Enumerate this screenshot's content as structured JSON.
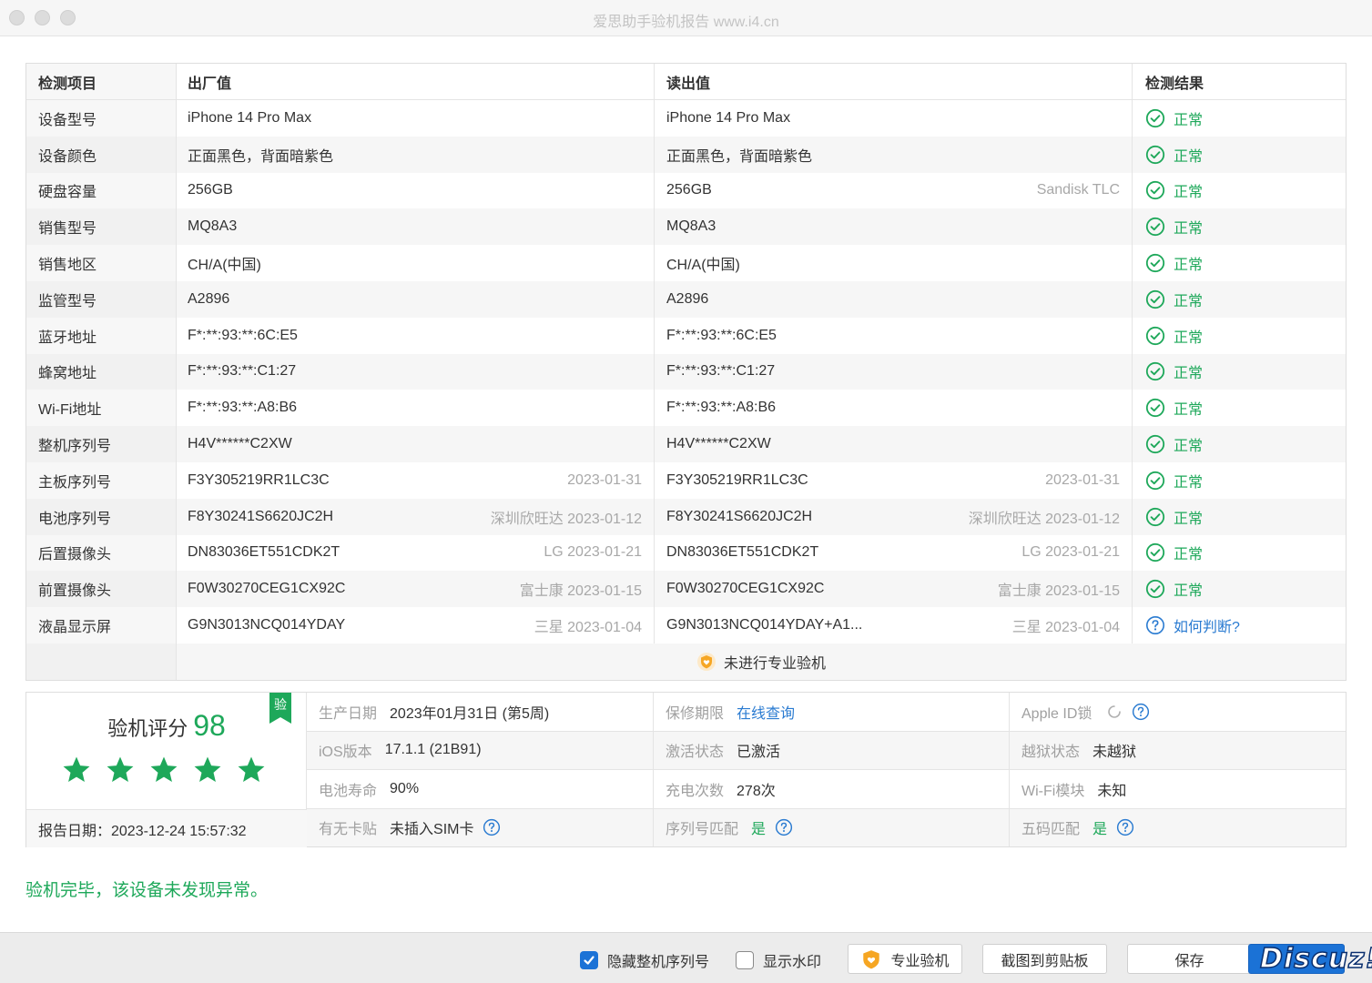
{
  "window": {
    "title": "爱思助手验机报告 www.i4.cn"
  },
  "table": {
    "headers": [
      "检测项目",
      "出厂值",
      "读出值",
      "检测结果"
    ],
    "rows": [
      {
        "item": "设备型号",
        "factory": "iPhone 14 Pro Max",
        "factory_sub": "",
        "read": "iPhone 14 Pro Max",
        "read_sub": "",
        "result": "正常",
        "status": "ok"
      },
      {
        "item": "设备颜色",
        "factory": "正面黑色，背面暗紫色",
        "factory_sub": "",
        "read": "正面黑色，背面暗紫色",
        "read_sub": "",
        "result": "正常",
        "status": "ok"
      },
      {
        "item": "硬盘容量",
        "factory": "256GB",
        "factory_sub": "",
        "read": "256GB",
        "read_sub": "Sandisk TLC",
        "result": "正常",
        "status": "ok"
      },
      {
        "item": "销售型号",
        "factory": "MQ8A3",
        "factory_sub": "",
        "read": "MQ8A3",
        "read_sub": "",
        "result": "正常",
        "status": "ok"
      },
      {
        "item": "销售地区",
        "factory": "CH/A(中国)",
        "factory_sub": "",
        "read": "CH/A(中国)",
        "read_sub": "",
        "result": "正常",
        "status": "ok"
      },
      {
        "item": "监管型号",
        "factory": "A2896",
        "factory_sub": "",
        "read": "A2896",
        "read_sub": "",
        "result": "正常",
        "status": "ok"
      },
      {
        "item": "蓝牙地址",
        "factory": "F*:**:93:**:6C:E5",
        "factory_sub": "",
        "read": "F*:**:93:**:6C:E5",
        "read_sub": "",
        "result": "正常",
        "status": "ok"
      },
      {
        "item": "蜂窝地址",
        "factory": "F*:**:93:**:C1:27",
        "factory_sub": "",
        "read": "F*:**:93:**:C1:27",
        "read_sub": "",
        "result": "正常",
        "status": "ok"
      },
      {
        "item": "Wi-Fi地址",
        "factory": "F*:**:93:**:A8:B6",
        "factory_sub": "",
        "read": "F*:**:93:**:A8:B6",
        "read_sub": "",
        "result": "正常",
        "status": "ok"
      },
      {
        "item": "整机序列号",
        "factory": "H4V******C2XW",
        "factory_sub": "",
        "read": "H4V******C2XW",
        "read_sub": "",
        "result": "正常",
        "status": "ok"
      },
      {
        "item": "主板序列号",
        "factory": "F3Y305219RR1LC3C",
        "factory_sub": "2023-01-31",
        "read": "F3Y305219RR1LC3C",
        "read_sub": "2023-01-31",
        "result": "正常",
        "status": "ok"
      },
      {
        "item": "电池序列号",
        "factory": "F8Y30241S6620JC2H",
        "factory_sub": "深圳欣旺达 2023-01-12",
        "read": "F8Y30241S6620JC2H",
        "read_sub": "深圳欣旺达 2023-01-12",
        "result": "正常",
        "status": "ok"
      },
      {
        "item": "后置摄像头",
        "factory": "DN83036ET551CDK2T",
        "factory_sub": "LG 2023-01-21",
        "read": "DN83036ET551CDK2T",
        "read_sub": "LG 2023-01-21",
        "result": "正常",
        "status": "ok"
      },
      {
        "item": "前置摄像头",
        "factory": "F0W30270CEG1CX92C",
        "factory_sub": "富士康 2023-01-15",
        "read": "F0W30270CEG1CX92C",
        "read_sub": "富士康 2023-01-15",
        "result": "正常",
        "status": "ok"
      },
      {
        "item": "液晶显示屏",
        "factory": "G9N3013NCQ014YDAY",
        "factory_sub": "三星 2023-01-04",
        "read": "G9N3013NCQ014YDAY+A1...",
        "read_sub": "三星 2023-01-04",
        "result": "如何判断?",
        "status": "ask"
      }
    ],
    "footer_note": "未进行专业验机"
  },
  "score": {
    "title": "验机评分",
    "value": "98",
    "stars": 5,
    "badge": "验",
    "report_date": "报告日期：2023-12-24 15:57:32"
  },
  "info": {
    "rows": [
      [
        {
          "label": "生产日期",
          "value": "2023年01月31日 (第5周)",
          "style": ""
        },
        {
          "label": "保修期限",
          "value": "在线查询",
          "style": "link"
        },
        {
          "label": "Apple ID锁",
          "value": "",
          "style": "",
          "spinner": true,
          "help": true
        }
      ],
      [
        {
          "label": "iOS版本",
          "value": "17.1.1 (21B91)",
          "style": ""
        },
        {
          "label": "激活状态",
          "value": "已激活",
          "style": ""
        },
        {
          "label": "越狱状态",
          "value": "未越狱",
          "style": ""
        }
      ],
      [
        {
          "label": "电池寿命",
          "value": "90%",
          "style": ""
        },
        {
          "label": "充电次数",
          "value": "278次",
          "style": ""
        },
        {
          "label": "Wi-Fi模块",
          "value": "未知",
          "style": ""
        }
      ],
      [
        {
          "label": "有无卡贴",
          "value": "未插入SIM卡",
          "style": "",
          "help": true
        },
        {
          "label": "序列号匹配",
          "value": "是",
          "style": "green",
          "help": true
        },
        {
          "label": "五码匹配",
          "value": "是",
          "style": "green",
          "help": true
        }
      ]
    ]
  },
  "result_message": "验机完毕，该设备未发现异常。",
  "bottom": {
    "hide_serial_label": "隐藏整机序列号",
    "hide_serial_checked": true,
    "show_watermark_label": "显示水印",
    "show_watermark_checked": false,
    "pro_check_label": "专业验机",
    "screenshot_label": "截图到剪贴板",
    "save_label": "保存",
    "watermark": "Discuz!"
  },
  "colors": {
    "accent_green": "#1ea85a",
    "link_blue": "#2a7bd1",
    "primary_button": "#1b72d6",
    "badge_orange": "#f6a623"
  }
}
